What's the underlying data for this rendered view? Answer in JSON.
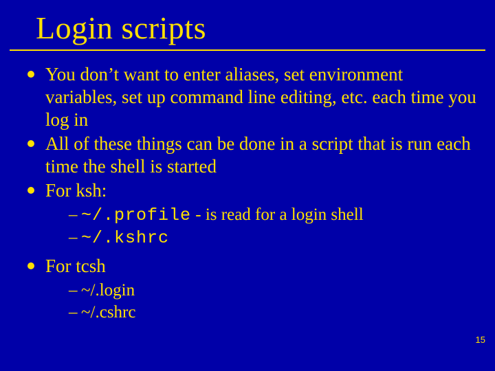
{
  "title": "Login scripts",
  "bullets": {
    "b1": "You don’t want to enter aliases, set environment variables, set up command line editing, etc. each time you log in",
    "b2": "All of these things can be done in a script that is run each time the shell is started",
    "b3": "For ksh:",
    "b3_sub": {
      "s1_code": "~/.profile",
      "s1_rest": " - is read for a login shell",
      "s2_code": "~/.kshrc"
    },
    "b4": "For tcsh",
    "b4_sub": {
      "s1": "~/.login",
      "s2": "~/.cshrc"
    }
  },
  "page_number": "15"
}
